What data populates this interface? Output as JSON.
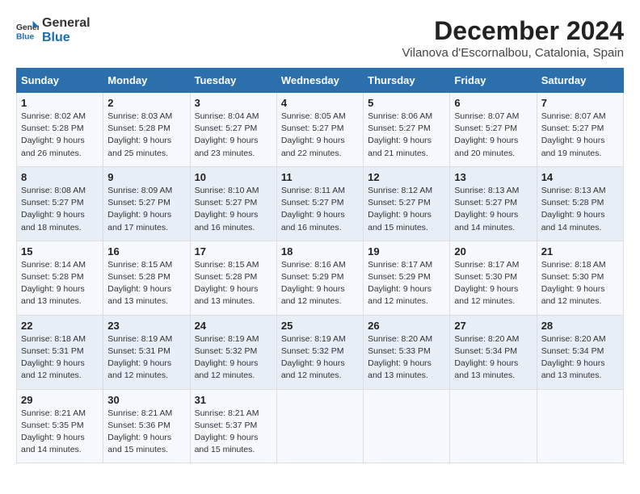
{
  "logo": {
    "text_general": "General",
    "text_blue": "Blue"
  },
  "title": {
    "month_year": "December 2024",
    "location": "Vilanova d'Escornalbou, Catalonia, Spain"
  },
  "weekdays": [
    "Sunday",
    "Monday",
    "Tuesday",
    "Wednesday",
    "Thursday",
    "Friday",
    "Saturday"
  ],
  "weeks": [
    [
      {
        "day": "1",
        "sunrise": "8:02 AM",
        "sunset": "5:28 PM",
        "daylight_hours": "9",
        "daylight_minutes": "26"
      },
      {
        "day": "2",
        "sunrise": "8:03 AM",
        "sunset": "5:28 PM",
        "daylight_hours": "9",
        "daylight_minutes": "25"
      },
      {
        "day": "3",
        "sunrise": "8:04 AM",
        "sunset": "5:27 PM",
        "daylight_hours": "9",
        "daylight_minutes": "23"
      },
      {
        "day": "4",
        "sunrise": "8:05 AM",
        "sunset": "5:27 PM",
        "daylight_hours": "9",
        "daylight_minutes": "22"
      },
      {
        "day": "5",
        "sunrise": "8:06 AM",
        "sunset": "5:27 PM",
        "daylight_hours": "9",
        "daylight_minutes": "21"
      },
      {
        "day": "6",
        "sunrise": "8:07 AM",
        "sunset": "5:27 PM",
        "daylight_hours": "9",
        "daylight_minutes": "20"
      },
      {
        "day": "7",
        "sunrise": "8:07 AM",
        "sunset": "5:27 PM",
        "daylight_hours": "9",
        "daylight_minutes": "19"
      }
    ],
    [
      {
        "day": "8",
        "sunrise": "8:08 AM",
        "sunset": "5:27 PM",
        "daylight_hours": "9",
        "daylight_minutes": "18"
      },
      {
        "day": "9",
        "sunrise": "8:09 AM",
        "sunset": "5:27 PM",
        "daylight_hours": "9",
        "daylight_minutes": "17"
      },
      {
        "day": "10",
        "sunrise": "8:10 AM",
        "sunset": "5:27 PM",
        "daylight_hours": "9",
        "daylight_minutes": "16"
      },
      {
        "day": "11",
        "sunrise": "8:11 AM",
        "sunset": "5:27 PM",
        "daylight_hours": "9",
        "daylight_minutes": "16"
      },
      {
        "day": "12",
        "sunrise": "8:12 AM",
        "sunset": "5:27 PM",
        "daylight_hours": "9",
        "daylight_minutes": "15"
      },
      {
        "day": "13",
        "sunrise": "8:13 AM",
        "sunset": "5:27 PM",
        "daylight_hours": "9",
        "daylight_minutes": "14"
      },
      {
        "day": "14",
        "sunrise": "8:13 AM",
        "sunset": "5:28 PM",
        "daylight_hours": "9",
        "daylight_minutes": "14"
      }
    ],
    [
      {
        "day": "15",
        "sunrise": "8:14 AM",
        "sunset": "5:28 PM",
        "daylight_hours": "9",
        "daylight_minutes": "13"
      },
      {
        "day": "16",
        "sunrise": "8:15 AM",
        "sunset": "5:28 PM",
        "daylight_hours": "9",
        "daylight_minutes": "13"
      },
      {
        "day": "17",
        "sunrise": "8:15 AM",
        "sunset": "5:28 PM",
        "daylight_hours": "9",
        "daylight_minutes": "13"
      },
      {
        "day": "18",
        "sunrise": "8:16 AM",
        "sunset": "5:29 PM",
        "daylight_hours": "9",
        "daylight_minutes": "12"
      },
      {
        "day": "19",
        "sunrise": "8:17 AM",
        "sunset": "5:29 PM",
        "daylight_hours": "9",
        "daylight_minutes": "12"
      },
      {
        "day": "20",
        "sunrise": "8:17 AM",
        "sunset": "5:30 PM",
        "daylight_hours": "9",
        "daylight_minutes": "12"
      },
      {
        "day": "21",
        "sunrise": "8:18 AM",
        "sunset": "5:30 PM",
        "daylight_hours": "9",
        "daylight_minutes": "12"
      }
    ],
    [
      {
        "day": "22",
        "sunrise": "8:18 AM",
        "sunset": "5:31 PM",
        "daylight_hours": "9",
        "daylight_minutes": "12"
      },
      {
        "day": "23",
        "sunrise": "8:19 AM",
        "sunset": "5:31 PM",
        "daylight_hours": "9",
        "daylight_minutes": "12"
      },
      {
        "day": "24",
        "sunrise": "8:19 AM",
        "sunset": "5:32 PM",
        "daylight_hours": "9",
        "daylight_minutes": "12"
      },
      {
        "day": "25",
        "sunrise": "8:19 AM",
        "sunset": "5:32 PM",
        "daylight_hours": "9",
        "daylight_minutes": "12"
      },
      {
        "day": "26",
        "sunrise": "8:20 AM",
        "sunset": "5:33 PM",
        "daylight_hours": "9",
        "daylight_minutes": "13"
      },
      {
        "day": "27",
        "sunrise": "8:20 AM",
        "sunset": "5:34 PM",
        "daylight_hours": "9",
        "daylight_minutes": "13"
      },
      {
        "day": "28",
        "sunrise": "8:20 AM",
        "sunset": "5:34 PM",
        "daylight_hours": "9",
        "daylight_minutes": "13"
      }
    ],
    [
      {
        "day": "29",
        "sunrise": "8:21 AM",
        "sunset": "5:35 PM",
        "daylight_hours": "9",
        "daylight_minutes": "14"
      },
      {
        "day": "30",
        "sunrise": "8:21 AM",
        "sunset": "5:36 PM",
        "daylight_hours": "9",
        "daylight_minutes": "15"
      },
      {
        "day": "31",
        "sunrise": "8:21 AM",
        "sunset": "5:37 PM",
        "daylight_hours": "9",
        "daylight_minutes": "15"
      },
      null,
      null,
      null,
      null
    ]
  ]
}
